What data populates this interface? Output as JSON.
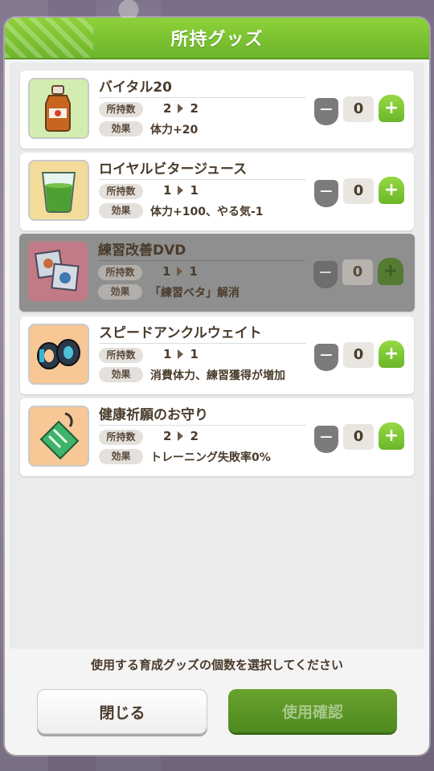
{
  "dialog": {
    "title": "所持グッズ"
  },
  "labels": {
    "owned": "所持数",
    "effect": "効果",
    "minus": "−",
    "plus": "+"
  },
  "items": [
    {
      "name": "バイタル20",
      "owned_from": "2",
      "owned_to": "2",
      "effect": "体力+20",
      "count": "0",
      "icon": "vital-bottle-icon",
      "disabled": false
    },
    {
      "name": "ロイヤルビタージュース",
      "owned_from": "1",
      "owned_to": "1",
      "effect": "体力+100、やる気-1",
      "count": "0",
      "icon": "green-juice-glass-icon",
      "disabled": false
    },
    {
      "name": "練習改善DVD",
      "owned_from": "1",
      "owned_to": "1",
      "effect": "「練習ベタ」解消",
      "count": "0",
      "icon": "dvd-case-icon",
      "disabled": true
    },
    {
      "name": "スピードアンクルウェイト",
      "owned_from": "1",
      "owned_to": "1",
      "effect": "消費体力、練習獲得が増加",
      "count": "0",
      "icon": "ankle-weight-icon",
      "disabled": false
    },
    {
      "name": "健康祈願のお守り",
      "owned_from": "2",
      "owned_to": "2",
      "effect": "トレーニング失敗率0%",
      "count": "0",
      "icon": "omamori-charm-icon",
      "disabled": false
    }
  ],
  "footer": {
    "instruction": "使用する育成グッズの個数を選択してください",
    "close_label": "閉じる",
    "confirm_label": "使用確認"
  },
  "colors": {
    "accent": "#7cc432",
    "text": "#4a3b2b"
  }
}
